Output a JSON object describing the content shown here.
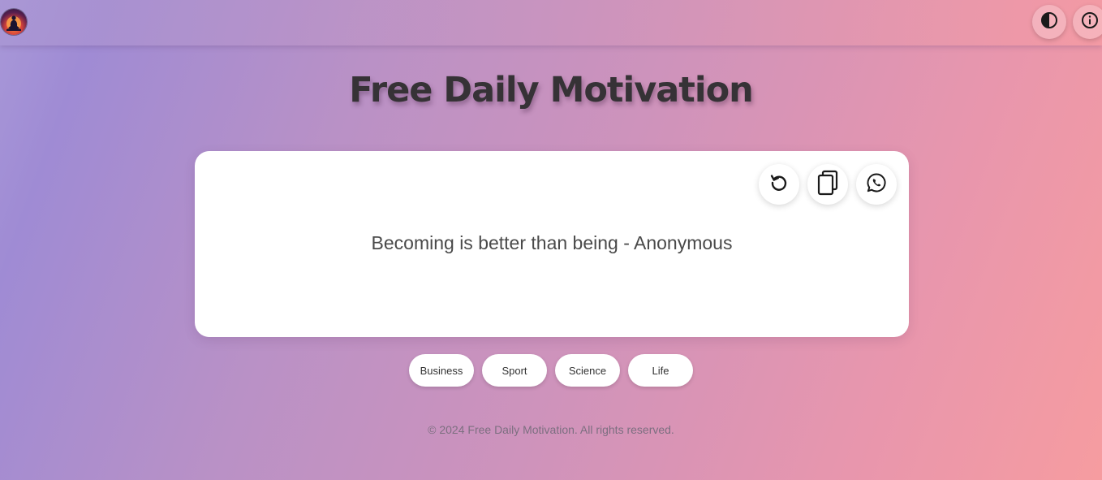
{
  "header": {
    "logo_icon": "meditation-logo-icon",
    "theme_toggle_icon": "contrast-icon",
    "info_icon": "info-icon"
  },
  "main": {
    "title": "Free Daily Motivation",
    "quote": "Becoming is better than being - Anonymous",
    "actions": [
      {
        "icon": "refresh-icon"
      },
      {
        "icon": "copy-icon"
      },
      {
        "icon": "whatsapp-icon"
      }
    ]
  },
  "categories": [
    "Business",
    "Sport",
    "Science",
    "Life"
  ],
  "footer": {
    "text": "© 2024 Free Daily Motivation. All rights reserved."
  },
  "colors": {
    "text_dark": "#363236",
    "card": "#ffffff",
    "gradient_start": "#a898d8",
    "gradient_end": "#f69ca0"
  }
}
